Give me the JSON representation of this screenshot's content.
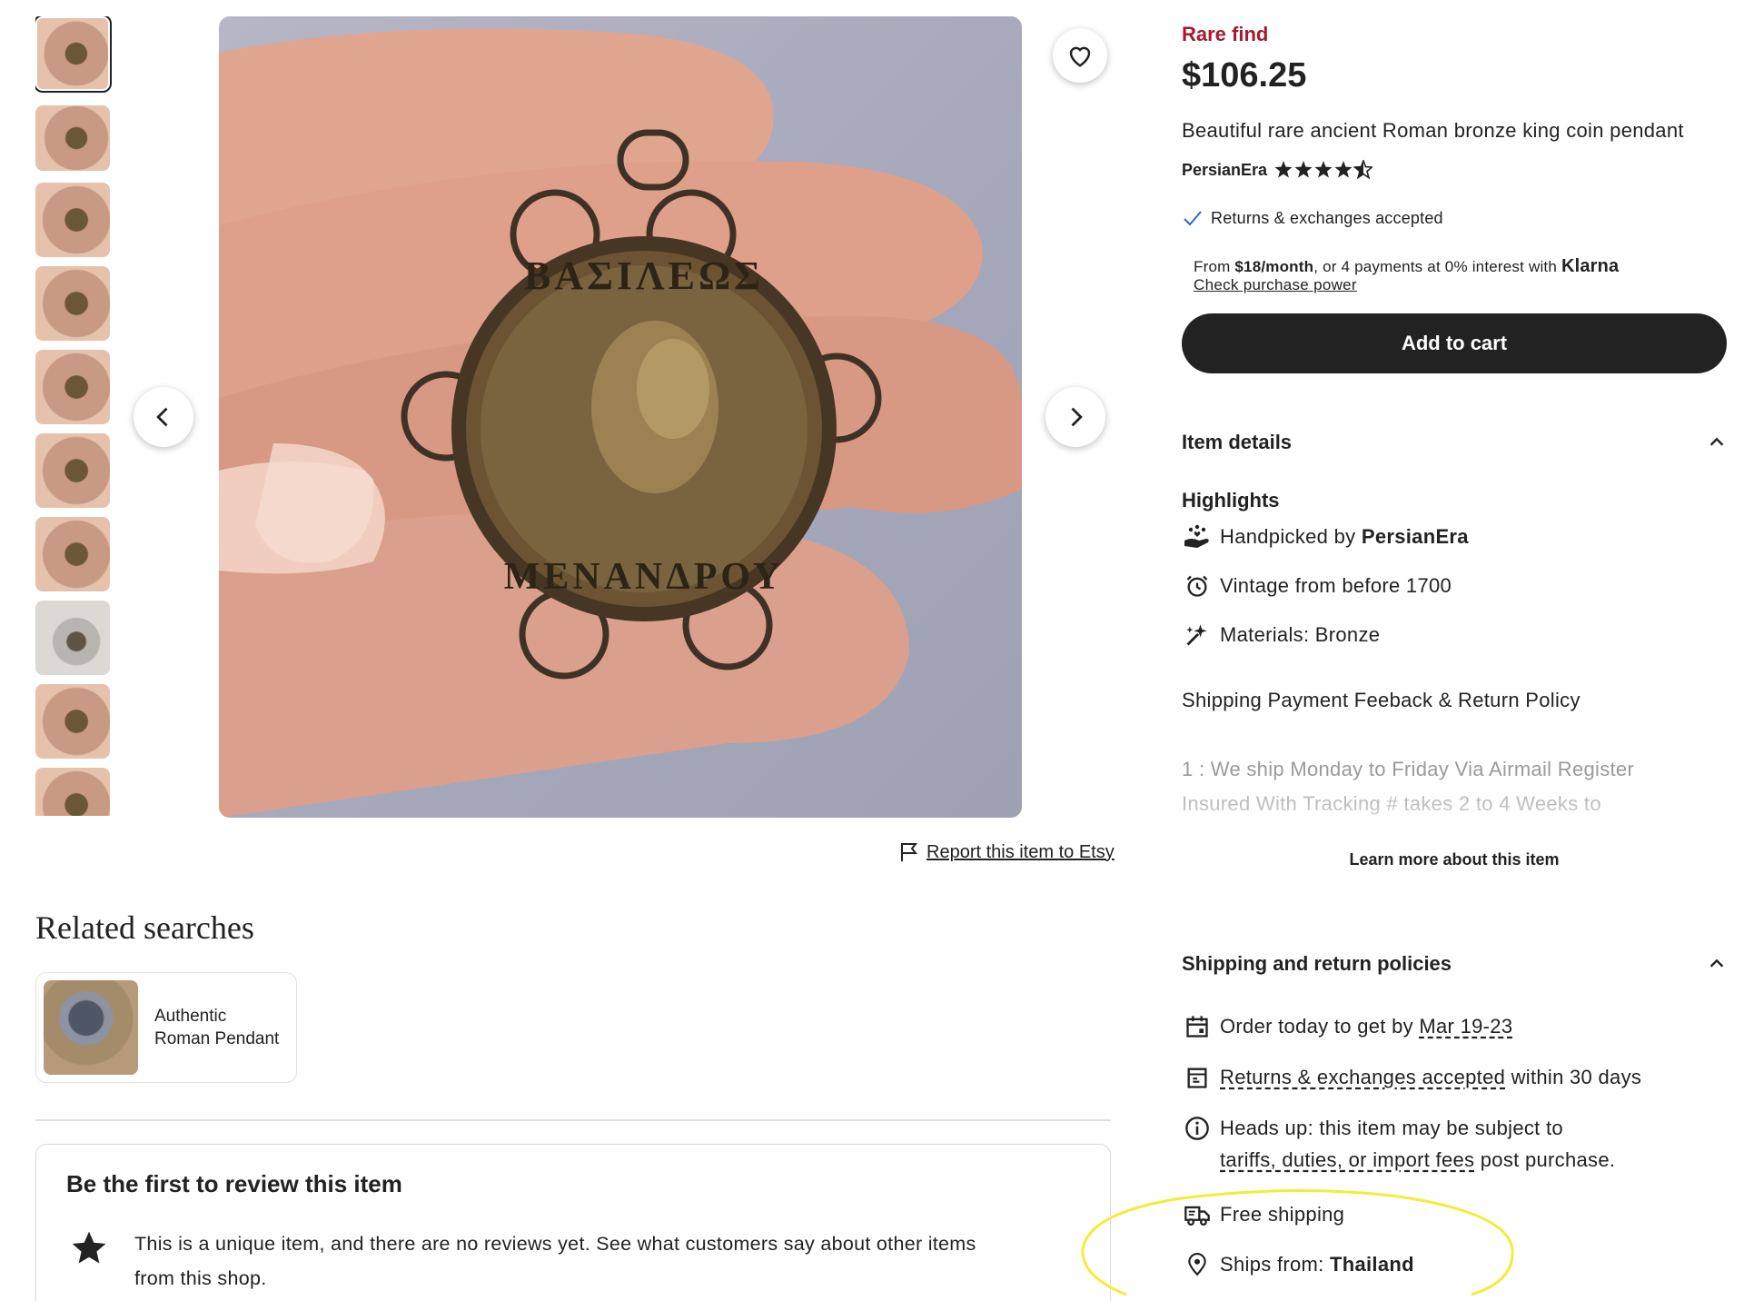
{
  "listing": {
    "badge": "Rare find",
    "price": "$106.25",
    "title": "Beautiful rare ancient Roman bronze king coin pendant",
    "shop": "PersianEra",
    "rating_stars": 4.5,
    "returns_label": "Returns & exchanges accepted",
    "klarna": {
      "prefix": "From ",
      "amount": "$18/month",
      "middle": ", or 4 payments at 0% interest with ",
      "brand": "Klarna",
      "link": "Check purchase power"
    },
    "add_to_cart": "Add to cart"
  },
  "gallery": {
    "thumbnail_count": 10,
    "report_link": "Report this item to Etsy"
  },
  "item_details": {
    "heading": "Item details",
    "highlights_heading": "Highlights",
    "handpicked_prefix": "Handpicked by ",
    "handpicked_shop": "PersianEra",
    "vintage": "Vintage from before 1700",
    "materials": "Materials: Bronze",
    "policy_heading": "Shipping Payment Feeback & Return Policy",
    "policy_line1": "1 : We ship Monday to Friday Via Airmail Register",
    "policy_line2": "Insured With Tracking # takes 2 to 4 Weeks to",
    "learn_more": "Learn more about this item"
  },
  "shipping": {
    "heading": "Shipping and return policies",
    "order_prefix": "Order today to get by ",
    "order_date": "Mar 19-23",
    "returns_link": "Returns & exchanges accepted",
    "returns_suffix": " within 30 days",
    "headsup_line1": "Heads up: this item may be subject to",
    "headsup_link": "tariffs, duties, or import fees",
    "headsup_suffix": " post purchase.",
    "free_shipping": "Free shipping",
    "ships_from_label": "Ships from: ",
    "ships_from_value": "Thailand"
  },
  "related": {
    "heading": "Related searches",
    "items": [
      {
        "label_line1": "Authentic",
        "label_line2": "Roman Pendant"
      }
    ]
  },
  "reviews": {
    "heading": "Be the first to review this item",
    "text_line1": "This is a unique item, and there are no reviews yet. See what customers say about other items",
    "text_line2": "from this shop."
  },
  "colors": {
    "rare_find": "#a61a2e",
    "button_dark": "#222222",
    "check_blue": "#2f66d0",
    "highlight_ellipse": "#f2ec3a"
  }
}
